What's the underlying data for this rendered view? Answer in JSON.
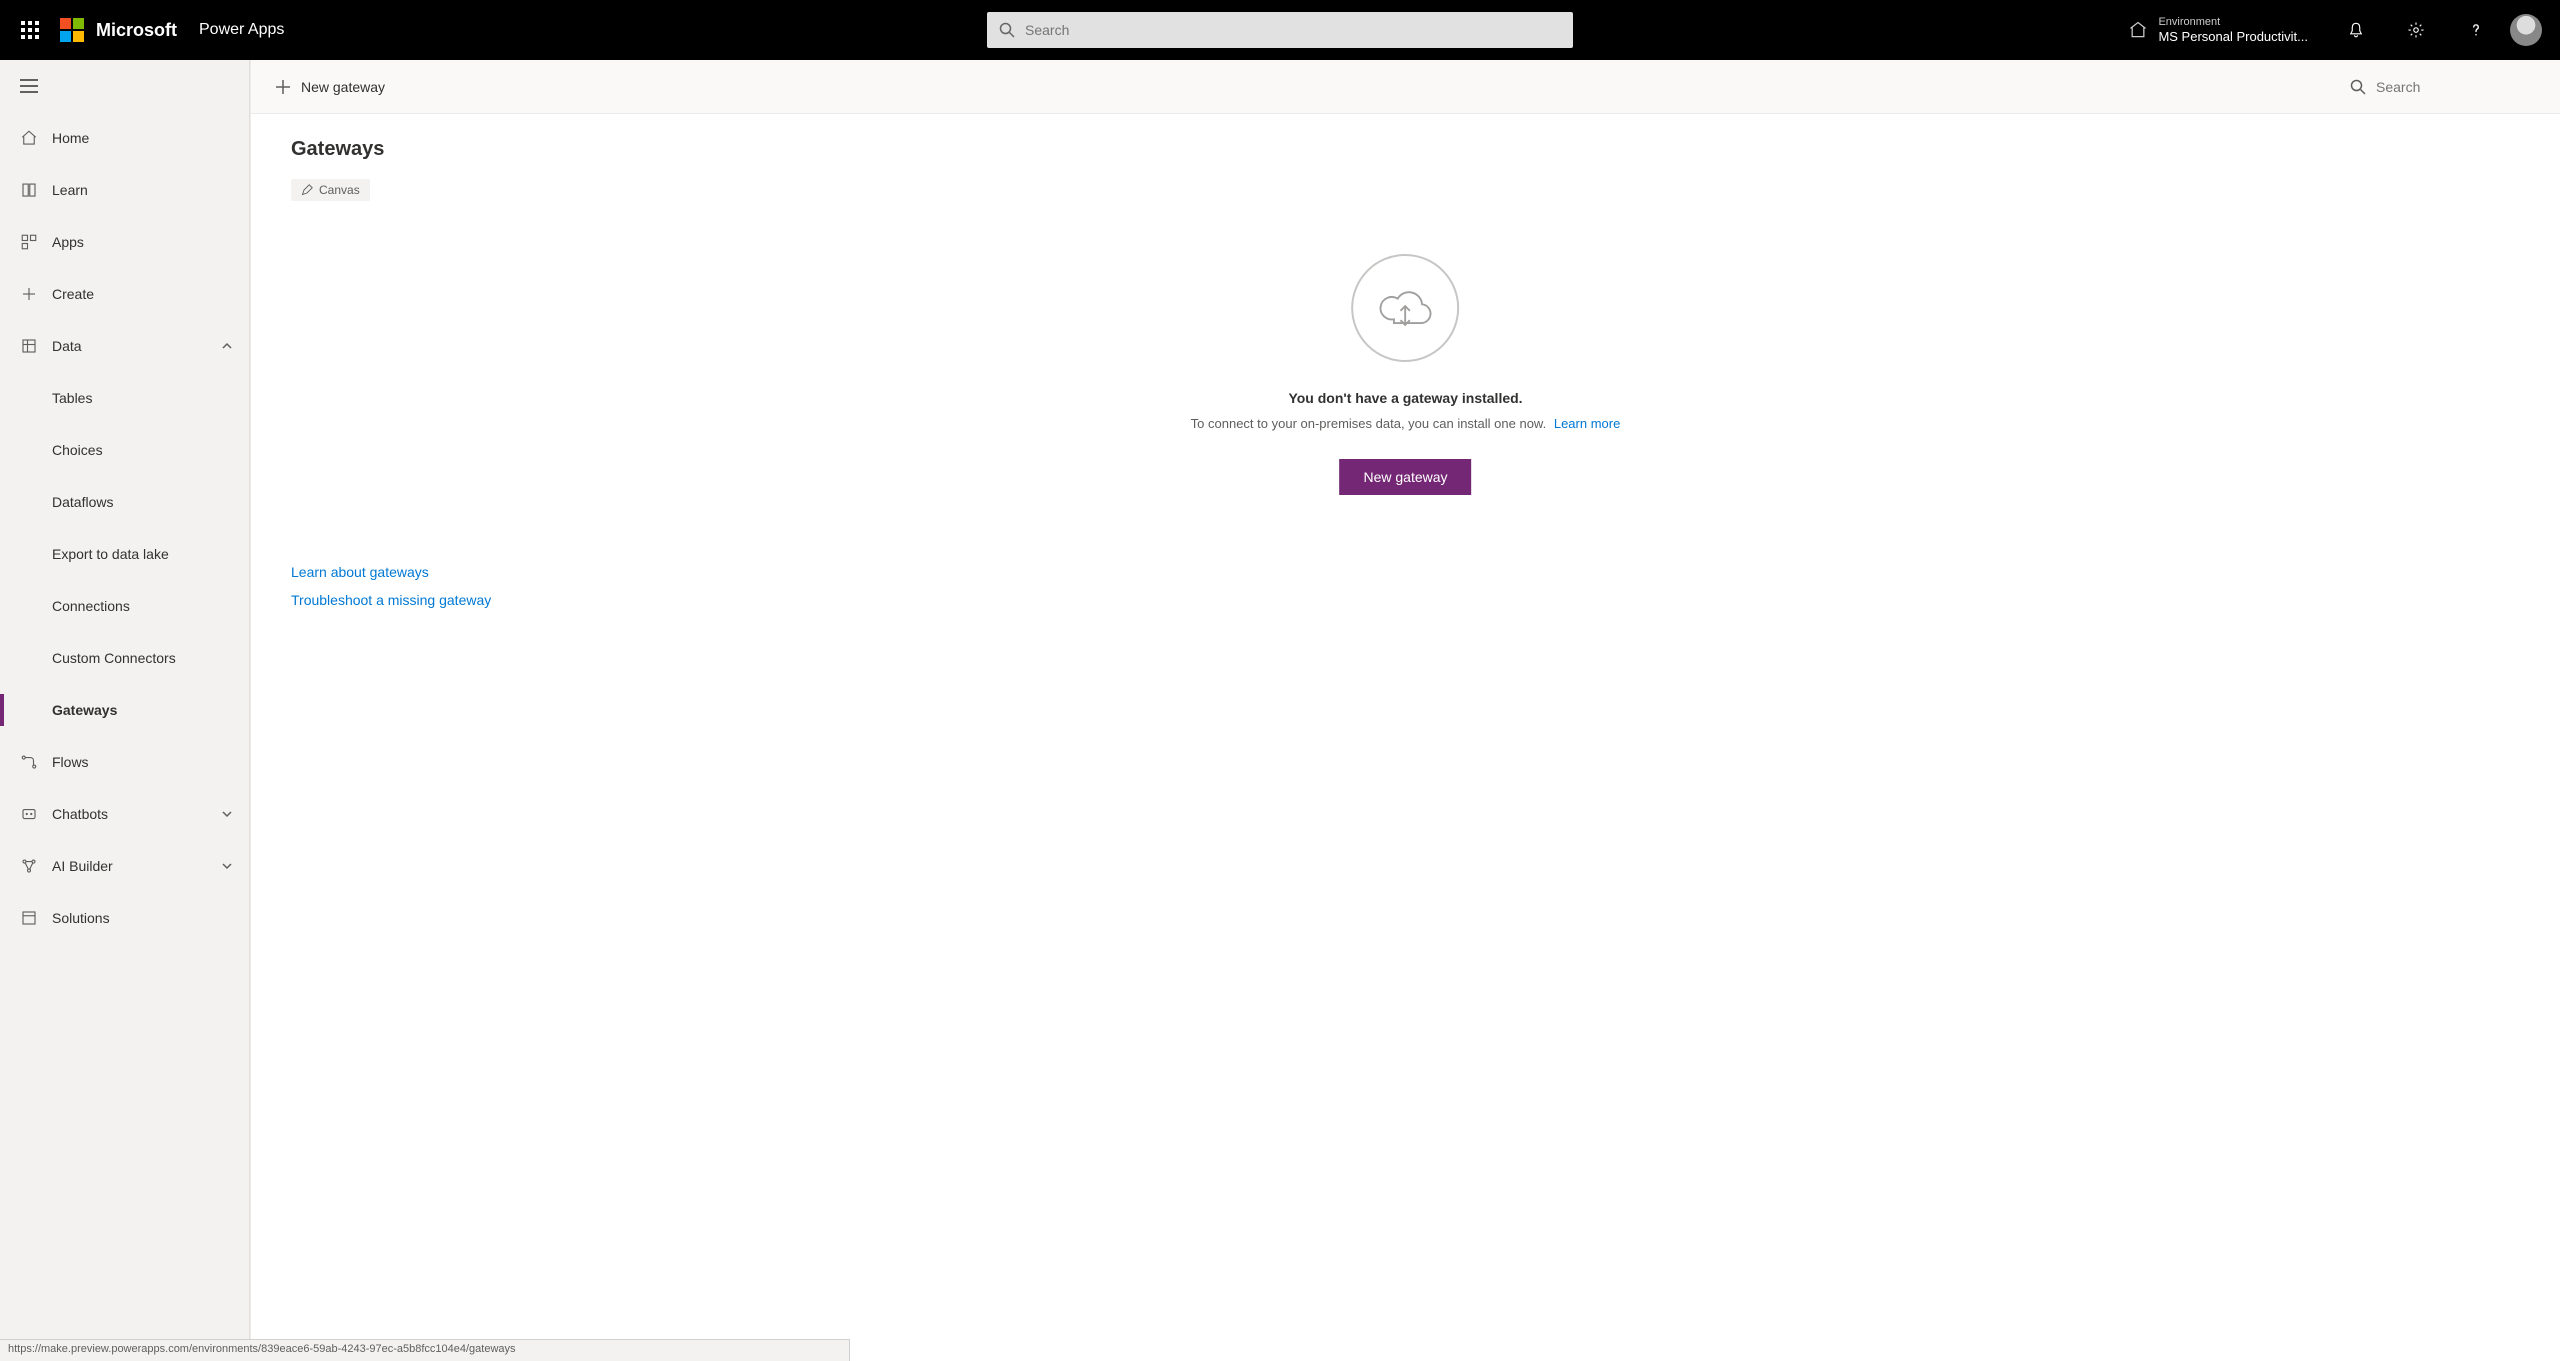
{
  "header": {
    "brand": "Microsoft",
    "app_name": "Power Apps",
    "search_placeholder": "Search",
    "environment_label": "Environment",
    "environment_name": "MS Personal Productivit..."
  },
  "sidebar": {
    "items": [
      {
        "label": "Home"
      },
      {
        "label": "Learn"
      },
      {
        "label": "Apps"
      },
      {
        "label": "Create"
      },
      {
        "label": "Data"
      },
      {
        "label": "Tables"
      },
      {
        "label": "Choices"
      },
      {
        "label": "Dataflows"
      },
      {
        "label": "Export to data lake"
      },
      {
        "label": "Connections"
      },
      {
        "label": "Custom Connectors"
      },
      {
        "label": "Gateways"
      },
      {
        "label": "Flows"
      },
      {
        "label": "Chatbots"
      },
      {
        "label": "AI Builder"
      },
      {
        "label": "Solutions"
      }
    ]
  },
  "commandbar": {
    "new_gateway": "New gateway",
    "search_placeholder": "Search"
  },
  "page": {
    "title": "Gateways",
    "chip_label": "Canvas",
    "empty_title": "You don't have a gateway installed.",
    "empty_sub": "To connect to your on-premises data, you can install one now.",
    "learn_more": "Learn more",
    "primary_button": "New gateway",
    "link_learn": "Learn about gateways",
    "link_troubleshoot": "Troubleshoot a missing gateway"
  },
  "statusbar": {
    "url": "https://make.preview.powerapps.com/environments/839eace6-59ab-4243-97ec-a5b8fcc104e4/gateways"
  }
}
